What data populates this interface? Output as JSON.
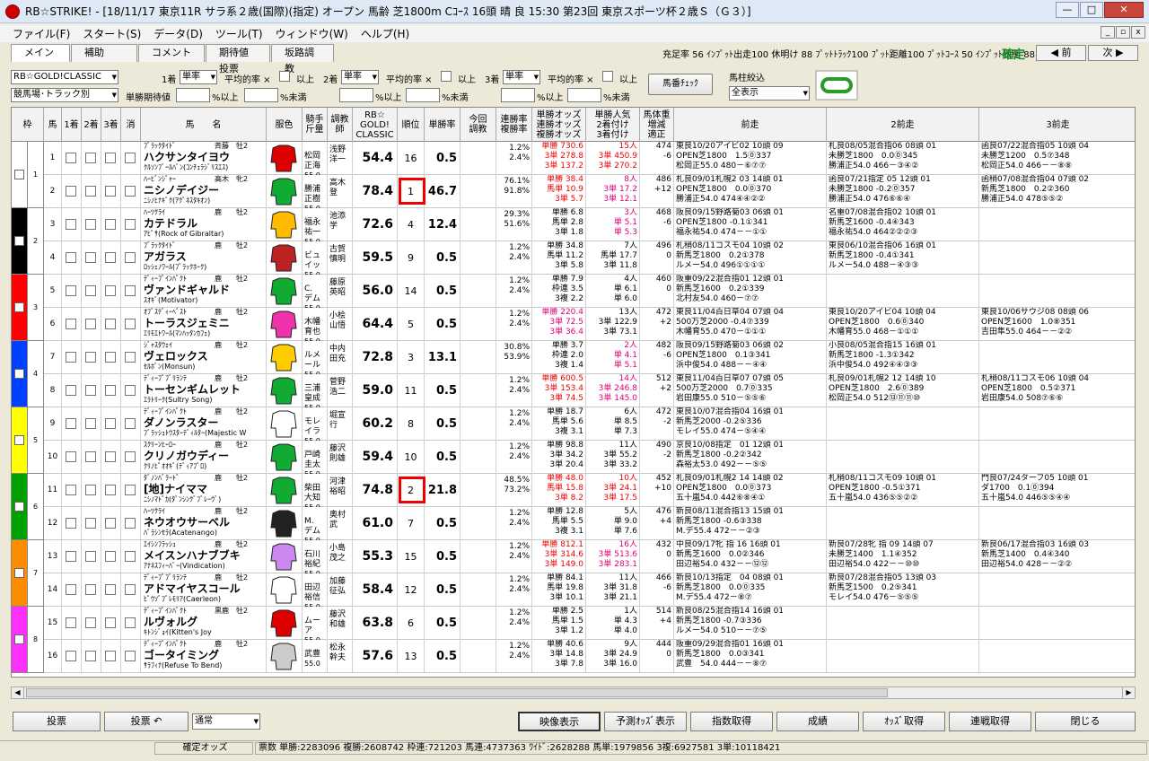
{
  "window": {
    "title": "RB☆STRIKE!  - [18/11/17 東京11R サラ系２歳(国際)(指定) オープン 馬齢 芝1800m Cｺｰｽ  16頭 晴 良 15:30 第23回 東京スポーツ杯２歳Ｓ（Ｇ３）]"
  },
  "menu": [
    "ファイル(F)",
    "スタート(S)",
    "データ(D)",
    "ツール(T)",
    "ウィンドウ(W)",
    "ヘルプ(H)"
  ],
  "tabs": [
    "メイン",
    "補助",
    "コメント",
    "期待値投票",
    "坂路調教"
  ],
  "stats": "充足率 56 ｲﾝﾌﾟｯﾄ出走100 休明け 88 ﾌﾟｯﾄﾄﾗｯｸ100 ﾌﾟｯﾄ距離100 ﾌﾟｯﾄｺｰｽ 50 ｲﾝﾌﾟｯﾄ状態 88",
  "confirmed": "確定",
  "nav": {
    "prev": "◀ 前",
    "next": "次 ▶"
  },
  "controls": {
    "index_select": "RB☆GOLD!CLASSIC",
    "sort_select": "競馬場･トラック別",
    "place1": "1着",
    "place2": "2着",
    "place3": "3着",
    "bet1": "単率",
    "bet2": "単率",
    "bet3": "単率",
    "avg_label": "平均的率 ×",
    "over": "以上",
    "ev_label": "単勝期待値",
    "pct_over": "%以上",
    "pct_under": "%未満",
    "umaban_check": "馬番ﾁｪｯｸ",
    "filter_label": "馬柱絞込",
    "filter_value": "全表示"
  },
  "headers": {
    "waku": "枠",
    "uma": "馬",
    "first": "1着",
    "second": "2着",
    "third": "3着",
    "scratch": "消",
    "name": "馬　　名",
    "silk": "服色",
    "jockey": "騎手\n斤量",
    "trainer": "調教\n師",
    "index": "RB☆\nGOLD!\nCLASSIC",
    "rank": "順位",
    "winrate": "単勝率",
    "comment": "今回\n調教",
    "winrates": "連勝率\n複勝率",
    "odds": "単勝オッズ\n連勝オッズ\n複勝オッズ",
    "pop": "単勝人気\n2着付け\n3着付け",
    "weight": "馬体重\n増減\n適正",
    "prev1": "前走",
    "prev2": "2前走",
    "prev3": "3前走"
  },
  "horses": [
    {
      "no": "1",
      "sire": "ﾌﾞﾗｯｸﾀｲﾄﾞ",
      "sex": "牡2",
      "owner": "斉藤",
      "name": "ハクサンタイヨウ",
      "dam": "ｸﾙｿﾝﾌﾞｰﾙﾊﾞﾝ(ｺﾝﾁｭﾗｼﾞﾘｽｴｽ)",
      "jockey": "松岡\n正海",
      "wt": "55.0",
      "trainer": "浅野\n洋一",
      "idx": "54.4",
      "rank": "16",
      "wr": "0.5",
      "r1": "1.2%\n2.4%",
      "o": "単勝 730.6\n3単 278.8\n3単 137.2",
      "o_hl": "red",
      "p": "15人\n3単 450.9\n3単 270.2",
      "p_hl": "red",
      "bw": "474\n-6\n",
      "pr1": "東良10/20アイビ02 10頭 09\nOPEN芝1800　1.5⓪337\n松岡正55.0 480－⑥⑦⑦",
      "pr2": "札良08/05混合指06 08頭 01\n未勝芝1800　0.0⓪345\n勝浦正54.0 466－③④②",
      "pr3": "函良07/22混合指05 10頭 04\n未勝芝1200　0.5⑦348\n松岡正54.0 466－－⑧⑧"
    },
    {
      "no": "2",
      "sire": "ﾊｰﾋﾞﾝｼﾞｬｰ",
      "sex": "牝2",
      "owner": "高木",
      "name": "ニシノデイジー",
      "dam": "ﾆｼﾉﾋﾅｷﾞｸ(ｱｸﾞﾈｽﾀｷｵﾝ)",
      "jockey": "勝浦\n正樹",
      "wt": "55.0",
      "trainer": "高木\n登",
      "idx": "78.4",
      "rank": "1",
      "wr": "46.7",
      "r1": "76.1%\n91.8%",
      "o": "単勝 38.4\n馬単 10.9\n3単 5.7",
      "o_hl": "red",
      "p": "8人\n3単 17.2\n3単 12.1",
      "p_hl": "pink",
      "bw": "486\n+12\n",
      "pr1": "札良09/01札幌2 03 14頭 01\nOPEN芝1800　0.0⓪370\n勝浦正54.0 474④④②②",
      "pr2": "函良07/21指定 05 12頭 01\n未勝芝1800 -0.2⓪357\n勝浦正54.0 476⑥⑥④",
      "pr3": "函稍07/08混合指04 07頭 02\n新馬芝1800　0.2②360\n勝浦正54.0 478⑤⑤②"
    },
    {
      "no": "3",
      "sire": "ﾊｰﾂｸﾗｲ",
      "sex": "牡2",
      "owner": "鹿",
      "name": "カテドラル",
      "dam": "ｱﾋﾟｻ(Rock of Gibraltar)",
      "jockey": "福永\n祐一",
      "wt": "55.0",
      "trainer": "池添\n学",
      "idx": "72.6",
      "rank": "4",
      "wr": "12.4",
      "r1": "29.3%\n51.6%",
      "o": "単勝 6.8\n馬単 2.8\n3単 1.8",
      "o_hl": "",
      "p": "3人\n単 5.1\n単 5.3",
      "p_hl": "pink",
      "bw": "468\n-6\n",
      "pr1": "阪良09/15野路菊03 06頭 01\nOPEN芝1800 -0.1①341\n福永祐54.0 474－－①①",
      "pr2": "名重07/08混合指02 10頭 01\n新馬芝1600 -0.4④343\n福永祐54.0 464②②②③",
      "pr3": ""
    },
    {
      "no": "4",
      "sire": "ﾌﾞﾗｯｸﾀｲﾄﾞ",
      "sex": "牡2",
      "owner": "鹿",
      "name": "アガラス",
      "dam": "ﾛｯｼｪﾉﾜｰﾙ(ﾌﾞﾗｯｸﾎｰｸ)",
      "jockey": "ビュ\nイッ",
      "wt": "55.0",
      "trainer": "古賀\n慎明",
      "idx": "59.5",
      "rank": "9",
      "wr": "0.5",
      "r1": "1.2%\n2.4%",
      "o": "単勝 34.8\n馬単 11.2\n3単 5.8",
      "o_hl": "",
      "p": "7人\n馬単 17.7\n3単 11.8",
      "p_hl": "",
      "bw": "496\n0\n",
      "pr1": "札稍08/11コスモ04 10頭 02\n新馬芝1800　0.2①378\nルメー54.0 496①①①①",
      "pr2": "東良06/10混合指06 16頭 01\n新馬芝1800 -0.4①341\nルメー54.0 488－④③③",
      "pr3": ""
    },
    {
      "no": "5",
      "sire": "ﾃﾞｨｰﾌﾟｲﾝﾊﾟｸﾄ",
      "sex": "牡2",
      "owner": "鹿",
      "name": "ヴァンドギャルド",
      "dam": "ｽｵｷﾞ(Motivator)",
      "jockey": "C.\nデム",
      "wt": "55.0",
      "trainer": "藤原\n英昭",
      "idx": "56.0",
      "rank": "14",
      "wr": "0.5",
      "r1": "1.2%\n2.4%",
      "o": "単勝 7.9\n枠連 3.5\n3複 2.2",
      "o_hl": "",
      "p": "4人\n単 6.1\n単 6.0",
      "p_hl": "",
      "bw": "460\n0\n",
      "pr1": "阪重09/22混合指01 12頭 01\n新馬芝1600　0.2①339\n北村友54.0 460－⑦⑦",
      "pr2": "",
      "pr3": ""
    },
    {
      "no": "6",
      "sire": "ｵﾌﾞｽﾃﾞｨｰﾍﾞｽﾄ",
      "sex": "牡2",
      "owner": "鹿",
      "name": "トーラスジェミニ",
      "dam": "ｴﾘﾓｴﾄﾜｰﾙ(ﾏﾝﾊｯﾀﾝｶﾌｪ)",
      "jockey": "木幡\n育也",
      "wt": "55.0",
      "trainer": "小桧\n山悟",
      "idx": "64.4",
      "rank": "5",
      "wr": "0.5",
      "r1": "1.2%\n2.4%",
      "o": "単勝 220.4\n3単 72.5\n3単 36.4",
      "o_hl": "pink",
      "p": "13人\n3単 122.9\n3単 73.1",
      "p_hl": "",
      "bw": "472\n+2\n",
      "pr1": "東良11/04百日草04 07頭 04\n500万芝2000 -0.4⑦339\n木幡育55.0 470－①①①",
      "pr2": "東良10/20アイビ04 10頭 04\nOPEN芝1800　0.6⓪340\n木幡育55.0 468－①①①",
      "pr3": "東良10/06サウジ08 08頭 06\nOPEN芝1600　1.0⑧351\n吉田隼55.0 464－－②②"
    },
    {
      "no": "7",
      "sire": "ｼﾞｬｽﾀｳｪｲ",
      "sex": "牡2",
      "owner": "鹿",
      "name": "ヴェロックス",
      "dam": "ｾﾙﾎﾞﾝ(Monsun)",
      "jockey": "ルメ\nール",
      "wt": "55.0",
      "trainer": "中内\n田充",
      "idx": "72.8",
      "rank": "3",
      "wr": "13.1",
      "r1": "30.8%\n53.9%",
      "o": "単勝 3.7\n枠連 2.0\n3複 1.4",
      "o_hl": "",
      "p": "2人\n単 4.1\n単 5.1",
      "p_hl": "pink",
      "bw": "482\n-6\n",
      "pr1": "阪良09/15野路菊03 06頭 02\nOPEN芝1800　0.1③341\n浜中俊54.0 488－－④④",
      "pr2": "小良08/05混合指15 16頭 01\n新馬芝1800 -1.3①342\n浜中俊54.0 492④④③③",
      "pr3": ""
    },
    {
      "no": "8",
      "sire": "ﾃﾞｨｰﾌﾟﾌﾞﾘﾗﾝﾃ",
      "sex": "牡2",
      "owner": "鹿",
      "name": "トーセンギムレット",
      "dam": "ｴﾗﾄﾘｰｸ(Sultry Song)",
      "jockey": "三浦\n皇成",
      "wt": "55.0",
      "trainer": "菅野\n浩二",
      "idx": "59.0",
      "rank": "11",
      "wr": "0.5",
      "r1": "1.2%\n2.4%",
      "o": "単勝 600.5\n3単 153.4\n3単 74.5",
      "o_hl": "red",
      "p": "14人\n3単 246.8\n3単 145.0",
      "p_hl": "pink",
      "bw": "512\n+2\n",
      "pr1": "東良11/04百日草07 07頭 05\n500万芝2000　0.7⓪335\n岩田康55.0 510－⑤⑤⑥",
      "pr2": "札良09/01札幌2 12 14頭 10\nOPEN芝1800　2.6⓪389\n松岡正54.0 512⑬⑪⑪⑩",
      "pr3": "札稍08/11コスモ06 10頭 04\nOPEN芝1800　0.5②371\n岩田康54.0 508⑦⑥⑥"
    },
    {
      "no": "9",
      "sire": "ﾃﾞｨｰﾌﾟｲﾝﾊﾟｸﾄ",
      "sex": "牡2",
      "owner": "鹿",
      "name": "ダノンラスター",
      "dam": "ﾌﾞﾗｯｼｭﾄｳｽﾀｰﾃﾞｨﾙﾀｰ(Majestic W",
      "jockey": "モレ\nイラ",
      "wt": "55.0",
      "trainer": "堀宣\n行",
      "idx": "60.2",
      "rank": "8",
      "wr": "0.5",
      "r1": "1.2%\n2.4%",
      "o": "単勝 18.7\n馬単 5.6\n3複 3.1",
      "o_hl": "",
      "p": "6人\n単 8.5\n単 7.3",
      "p_hl": "",
      "bw": "472\n-2\n",
      "pr1": "東良10/07混合指04 16頭 01\n新馬芝2000 -0.2⑤336\nモレイ55.0 474－⑤④④",
      "pr2": "",
      "pr3": ""
    },
    {
      "no": "10",
      "sire": "ｽｸﾘｰﾝﾋｰﾛｰ",
      "sex": "牡2",
      "owner": "鹿",
      "name": "クリノガウディー",
      "dam": "ｸﾘﾉﾋﾟｵｵｷﾞ(ﾃﾞｨｱﾌﾞﾛ)",
      "jockey": "戸崎\n圭太",
      "wt": "55.0",
      "trainer": "藤沢\n則雄",
      "idx": "59.4",
      "rank": "10",
      "wr": "0.5",
      "r1": "1.2%\n2.4%",
      "o": "単勝 98.8\n3単 34.2\n3単 20.4",
      "o_hl": "",
      "p": "11人\n3単 55.2\n3単 33.2",
      "p_hl": "",
      "bw": "490\n-2\n",
      "pr1": "京良10/08指定　01 12頭 01\n新馬芝1800 -0.2②342\n森裕太53.0 492－－⑤⑤",
      "pr2": "",
      "pr3": ""
    },
    {
      "no": "11",
      "sire": "ﾀﾞﾉﾝﾊﾞﾗｰﾄﾞ",
      "sex": "牡2",
      "owner": "鹿",
      "name": "[地]ナイママ",
      "dam": "ﾆｼﾉﾏﾄﾞｶ(ﾀﾞﾝｼﾝｸﾞﾌﾞﾚｰｳﾞ)",
      "jockey": "柴田\n大知",
      "wt": "55.0",
      "trainer": "河津\n裕昭",
      "idx": "74.8",
      "rank": "2",
      "wr": "21.8",
      "r1": "48.5%\n73.2%",
      "o": "単勝 48.0\n馬単 15.8\n3単 8.2",
      "o_hl": "red",
      "p": "10人\n3単 24.1\n3単 17.5",
      "p_hl": "red",
      "bw": "452\n+10\n",
      "pr1": "札良09/01札幌2 14 14頭 02\nOPEN芝1800　0.0⓪373\n五十嵐54.0 442⑥⑧④①",
      "pr2": "札稍08/11コスモ09 10頭 01\nOPEN芝1800 -0.5①371\n五十嵐54.0 436⑤⑤②②",
      "pr3": "門良07/24ターフ05 10頭 01\nダ1700　0.1⓪394\n五十嵐54.0 446⑤⑤④④"
    },
    {
      "no": "12",
      "sire": "ﾊｰﾂｸﾗｲ",
      "sex": "牡2",
      "owner": "鹿",
      "name": "ネウオウサーベル",
      "dam": "ﾊﾞﾗｼﾝｾﾗ(Acatenango)",
      "jockey": "M.\nデム",
      "wt": "55.0",
      "trainer": "奥村\n武",
      "idx": "61.0",
      "rank": "7",
      "wr": "0.5",
      "r1": "1.2%\n2.4%",
      "o": "単勝 12.8\n馬単 5.5\n3複 3.1",
      "o_hl": "",
      "p": "5人\n単 9.0\n単 7.6",
      "p_hl": "",
      "bw": "476\n+4\n",
      "pr1": "新良08/11混合指13 15頭 01\n新馬芝1800 -0.6③338\nM.デ55.4 472－－②③",
      "pr2": "",
      "pr3": ""
    },
    {
      "no": "13",
      "sire": "ｴｲｼﾝﾌﾗｯｼｭ",
      "sex": "牡2",
      "owner": "鹿",
      "name": "メイスンハナブブキ",
      "dam": "ｱﾅﾈｽﾌｨｰﾊﾞｰ(Vindication)",
      "jockey": "石川\n裕紀",
      "wt": "55.0",
      "trainer": "小島\n茂之",
      "idx": "55.3",
      "rank": "15",
      "wr": "0.5",
      "r1": "1.2%\n2.4%",
      "o": "単勝 812.1\n3単 314.6\n3単 149.0",
      "o_hl": "red",
      "p": "16人\n3単 513.6\n3単 283.1",
      "p_hl": "pink",
      "bw": "432\n0\n",
      "pr1": "中良09/17牝 指 16 16頭 01\n新馬芝1600　0.0②346\n田辺裕54.0 432－－⑫⑫",
      "pr2": "新良07/28牝 指 09 14頭 07\n未勝芝1400　1.1④352\n田辺裕54.0 422－－⑩⑩",
      "pr3": "新良06/17混合指03 16頭 03\n新馬芝1400　0.4④340\n田辺裕54.0 428－－②②"
    },
    {
      "no": "14",
      "sire": "ﾃﾞｨｰﾌﾟﾌﾞﾘﾗﾝﾃ",
      "sex": "牡2",
      "owner": "鹿",
      "name": "アドマイヤスコール",
      "dam": "ﾋﾟｳｿﾞﾌﾟﾚﾓﾘｱ(Caerleon)",
      "jockey": "田辺\n裕信",
      "wt": "55.0",
      "trainer": "加藤\n征弘",
      "idx": "58.4",
      "rank": "12",
      "wr": "0.5",
      "r1": "1.2%\n2.4%",
      "o": "単勝 84.1\n馬単 19.8\n3単 10.1",
      "o_hl": "",
      "p": "11人\n3単 31.8\n3単 21.1",
      "p_hl": "",
      "bw": "466\n-6\n",
      "pr1": "新良10/13指定　04 08頭 01\n新馬芝1800　0.0⓪335\nM.デ55.4 472－⑧⑦",
      "pr2": "新良07/28混合指05 13頭 03\n新馬芝1500　0.2⑤341\nモレイ54.0 476－⑤⑤⑤",
      "pr3": ""
    },
    {
      "no": "15",
      "sire": "ﾃﾞｨｰﾌﾟｲﾝﾊﾟｸﾄ",
      "sex": "牡2",
      "owner": "黒鹿",
      "name": "ルヴォルグ",
      "dam": "ｷﾄﾝｼﾞｮｲ(Kitten's Joy",
      "jockey": "ムー\nア",
      "wt": "55.0",
      "trainer": "藤沢\n和雄",
      "idx": "63.8",
      "rank": "6",
      "wr": "0.5",
      "r1": "1.2%\n2.4%",
      "o": "単勝 2.5\n馬単 1.5\n3単 1.2",
      "o_hl": "",
      "p": "1人\n単 4.3\n単 4.0",
      "p_hl": "",
      "bw": "514\n+4\n",
      "pr1": "新良08/25混合指14 16頭 01\n新馬芝1800 -0.7③336\nルメー54.0 510－－⑦⑤",
      "pr2": "",
      "pr3": ""
    },
    {
      "no": "16",
      "sire": "ﾃﾞｨｰﾌﾟｲﾝﾊﾟｸﾄ",
      "sex": "牡2",
      "owner": "鹿",
      "name": "ゴータイミング",
      "dam": "ｻﾗﾌｨﾅ(Refuse To Bend)",
      "jockey": "武豊",
      "wt": "55.0",
      "trainer": "松永\n幹夫",
      "idx": "57.6",
      "rank": "13",
      "wr": "0.5",
      "r1": "1.2%\n2.4%",
      "o": "単勝 40.6\n3単 14.8\n3単 7.8",
      "o_hl": "",
      "p": "9人\n3単 24.9\n3単 16.0",
      "p_hl": "",
      "bw": "444\n0\n",
      "pr1": "阪重09/29混合指01 16頭 01\n新馬芝1800　0.0③341\n武豊　54.0 444－－⑧⑦",
      "pr2": "",
      "pr3": ""
    }
  ],
  "silks": [
    "#d00",
    "#1a3",
    "#fb0",
    "#b22",
    "#1a3",
    "#e3a",
    "#fc0",
    "#1a3",
    "#fff",
    "#1a3",
    "#1a3",
    "#222",
    "#c8e",
    "#fff",
    "#d00",
    "#ccc"
  ],
  "waku_colors": [
    "#ffffff",
    "#000000",
    "#ff0000",
    "#0040ff",
    "#ffff00",
    "#00a000",
    "#ff8c00",
    "#ff30ff"
  ],
  "bottom": {
    "vote": "投票",
    "vote2": "投票 ↶",
    "mode": "通常",
    "video": "映像表示",
    "pred_odds": "予測ｵｯｽﾞ表示",
    "index_get": "指数取得",
    "result": "成績",
    "odds_get": "ｵｯｽﾞ取得",
    "series_get": "連戦取得",
    "close": "閉じる"
  },
  "status": {
    "confirm_odds": "確定オッズ",
    "sales": "票数  単勝:2283096  複勝:2608742  枠連:721203  馬連:4737363  ﾜｲﾄﾞ:2628288  馬単:1979856  3複:6927581  3単:10118421"
  }
}
